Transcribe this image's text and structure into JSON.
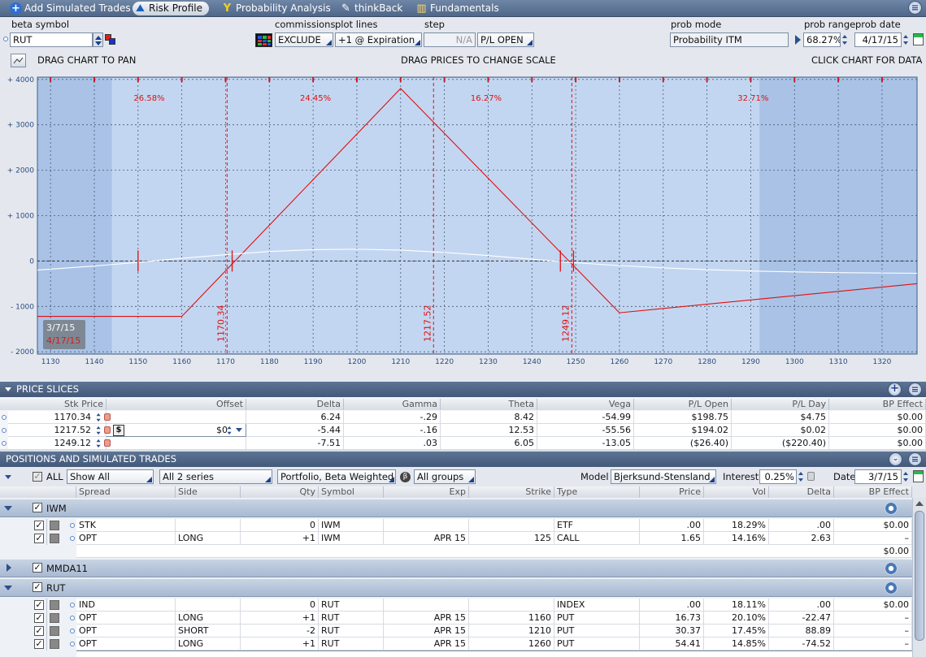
{
  "tabs": [
    {
      "label": "Add Simulated Trades",
      "icon": "plus-icon",
      "active": false
    },
    {
      "label": "Risk Profile",
      "icon": "risk-profile-icon",
      "active": true
    },
    {
      "label": "Probability Analysis",
      "icon": "probability-icon",
      "active": false
    },
    {
      "label": "thinkBack",
      "icon": "thinkback-icon",
      "active": false
    },
    {
      "label": "Fundamentals",
      "icon": "fundamentals-icon",
      "active": false
    }
  ],
  "controls": {
    "beta_symbol_label": "beta symbol",
    "beta_symbol": "RUT",
    "commissions_label": "commissions",
    "commissions": "EXCLUDE",
    "plot_lines_label": "plot lines",
    "plot_lines": "+1 @ Expiration",
    "step_label": "step",
    "step": "N/A",
    "pl_mode": "P/L OPEN",
    "prob_mode_label": "prob mode",
    "prob_mode": "Probability ITM",
    "prob_range_label": "prob range",
    "prob_range": "68.27%",
    "prob_date_label": "prob date",
    "prob_date": "4/17/15"
  },
  "chart_hints": {
    "left": "DRAG CHART TO PAN",
    "center": "DRAG PRICES TO CHANGE SCALE",
    "right": "CLICK CHART FOR DATA"
  },
  "chart_data": {
    "type": "line",
    "xlim": [
      1127,
      1328
    ],
    "ylim": [
      -2050,
      4050
    ],
    "x_ticks": [
      1130,
      1140,
      1150,
      1160,
      1170,
      1180,
      1190,
      1200,
      1210,
      1220,
      1230,
      1240,
      1250,
      1260,
      1270,
      1280,
      1290,
      1300,
      1310,
      1320
    ],
    "y_ticks": [
      {
        "v": 4000,
        "t": "+ 4000"
      },
      {
        "v": 3000,
        "t": "+ 3000"
      },
      {
        "v": 2000,
        "t": "+ 2000"
      },
      {
        "v": 1000,
        "t": "+ 1000"
      },
      {
        "v": 0,
        "t": "0"
      },
      {
        "v": -1000,
        "t": "- 1000"
      },
      {
        "v": -2000,
        "t": "- 2000"
      }
    ],
    "prob_zones": [
      {
        "from": 1144,
        "to": 1292
      }
    ],
    "prob_labels": [
      {
        "x": 1149,
        "text": "26.58%"
      },
      {
        "x": 1187,
        "text": "24.45%"
      },
      {
        "x": 1226,
        "text": "16.27%"
      },
      {
        "x": 1287,
        "text": "32.71%"
      }
    ],
    "price_slices": [
      {
        "x": 1170.34,
        "label": "1170.34"
      },
      {
        "x": 1217.52,
        "label": "1217.52"
      },
      {
        "x": 1249.12,
        "label": "1249.12"
      }
    ],
    "series": [
      {
        "name": "4/17/15",
        "color": "#e01010",
        "x": [
          1127,
          1160,
          1210,
          1260,
          1328
        ],
        "y": [
          -1220,
          -1220,
          3800,
          -1140,
          -500
        ]
      },
      {
        "name": "3/7/15",
        "color": "#ffffff",
        "x": [
          1127,
          1140,
          1150,
          1160,
          1170,
          1180,
          1190,
          1200,
          1210,
          1220,
          1230,
          1240,
          1250,
          1260,
          1270,
          1280,
          1290,
          1300,
          1310,
          1320,
          1328
        ],
        "y": [
          -200,
          -110,
          -30,
          60,
          140,
          210,
          250,
          260,
          240,
          190,
          120,
          40,
          -40,
          -100,
          -150,
          -190,
          -220,
          -240,
          -255,
          -265,
          -270
        ]
      }
    ],
    "legend": {
      "date1": "3/7/15",
      "date2": "4/17/15"
    }
  },
  "price_slices_section": {
    "title": "PRICE SLICES",
    "columns": [
      "Stk Price",
      "Offset",
      "Delta",
      "Gamma",
      "Theta",
      "Vega",
      "P/L Open",
      "P/L Day",
      "BP Effect"
    ],
    "rows": [
      {
        "price": "1170.34",
        "offset": "",
        "delta": "6.24",
        "gamma": "-.29",
        "theta": "8.42",
        "vega": "-54.99",
        "pl_open": "$198.75",
        "pl_day": "$4.75",
        "bp": "$0.00"
      },
      {
        "price": "1217.52",
        "offset": "$0",
        "delta": "-5.44",
        "gamma": "-.16",
        "theta": "12.53",
        "vega": "-55.56",
        "pl_open": "$194.02",
        "pl_day": "$0.02",
        "bp": "$0.00"
      },
      {
        "price": "1249.12",
        "offset": "",
        "delta": "-7.51",
        "gamma": ".03",
        "theta": "6.05",
        "vega": "-13.05",
        "pl_open": "($26.40)",
        "pl_day": "($220.40)",
        "bp": "$0.00"
      }
    ]
  },
  "positions_section": {
    "title": "POSITIONS AND SIMULATED TRADES",
    "filter_all": "ALL",
    "show": "Show All",
    "series": "All 2 series",
    "portfolio": "Portfolio, Beta Weighted",
    "groups": "All groups",
    "model_label": "Model",
    "model": "Bjerksund-Stensland",
    "interest_label": "Interest",
    "interest": "0.25%",
    "date_label": "Date",
    "date": "3/7/15",
    "columns": [
      "Spread",
      "Side",
      "Qty",
      "Symbol",
      "Exp",
      "Strike",
      "Type",
      "Price",
      "Vol",
      "Delta",
      "BP Effect"
    ],
    "groups_list": [
      {
        "name": "IWM",
        "expanded": true,
        "rows": [
          {
            "spread": "STK",
            "side": "",
            "qty": "0",
            "symbol": "IWM",
            "exp": "",
            "strike": "",
            "type": "ETF",
            "price": ".00",
            "vol": "18.29%",
            "delta": ".00",
            "bp": "$0.00"
          },
          {
            "spread": "OPT",
            "side": "LONG",
            "qty": "+1",
            "symbol": "IWM",
            "exp": "APR 15",
            "strike": "125",
            "type": "CALL",
            "price": "1.65",
            "vol": "14.16%",
            "delta": "2.63",
            "bp": "–"
          }
        ],
        "total": "$0.00"
      },
      {
        "name": "MMDA11",
        "expanded": false,
        "rows": []
      },
      {
        "name": "RUT",
        "expanded": true,
        "rows": [
          {
            "spread": "IND",
            "side": "",
            "qty": "0",
            "symbol": "RUT",
            "exp": "",
            "strike": "",
            "type": "INDEX",
            "price": ".00",
            "vol": "18.11%",
            "delta": ".00",
            "bp": "$0.00"
          },
          {
            "spread": "OPT",
            "side": "LONG",
            "qty": "+1",
            "symbol": "RUT",
            "exp": "APR 15",
            "strike": "1160",
            "type": "PUT",
            "price": "16.73",
            "vol": "20.10%",
            "delta": "-22.47",
            "bp": "–"
          },
          {
            "spread": "OPT",
            "side": "SHORT",
            "qty": "-2",
            "symbol": "RUT",
            "exp": "APR 15",
            "strike": "1210",
            "type": "PUT",
            "price": "30.37",
            "vol": "17.45%",
            "delta": "88.89",
            "bp": "–"
          },
          {
            "spread": "OPT",
            "side": "LONG",
            "qty": "+1",
            "symbol": "RUT",
            "exp": "APR 15",
            "strike": "1260",
            "type": "PUT",
            "price": "54.41",
            "vol": "14.85%",
            "delta": "-74.52",
            "bp": "–"
          }
        ]
      }
    ]
  }
}
